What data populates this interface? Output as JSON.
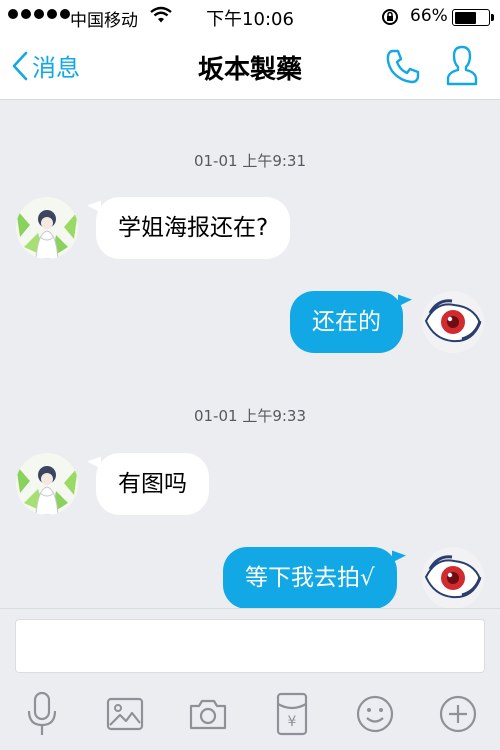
{
  "status_bar": {
    "carrier": "中国移动",
    "time": "下午10:06",
    "battery": "66%",
    "battery_level": 0.66
  },
  "nav": {
    "back_label": "消息",
    "title": "坂本製藥"
  },
  "messages": [
    {
      "timestamp": "01-01 上午9:31"
    },
    {
      "sender": "contact",
      "text": "学姐海报还在?"
    },
    {
      "sender": "me",
      "text": "还在的"
    },
    {
      "timestamp": "01-01 上午9:33"
    },
    {
      "sender": "contact",
      "text": "有图吗"
    },
    {
      "sender": "me",
      "text": "等下我去拍√"
    }
  ],
  "input": {
    "placeholder": ""
  },
  "toolbar": {
    "icons": [
      "microphone-icon",
      "image-icon",
      "camera-icon",
      "red-packet-icon",
      "emoji-icon",
      "plus-icon"
    ]
  },
  "colors": {
    "accent": "#12a8e6",
    "background": "#ebedf1",
    "incoming_bubble": "#ffffff",
    "outgoing_bubble": "#12a8e6"
  }
}
